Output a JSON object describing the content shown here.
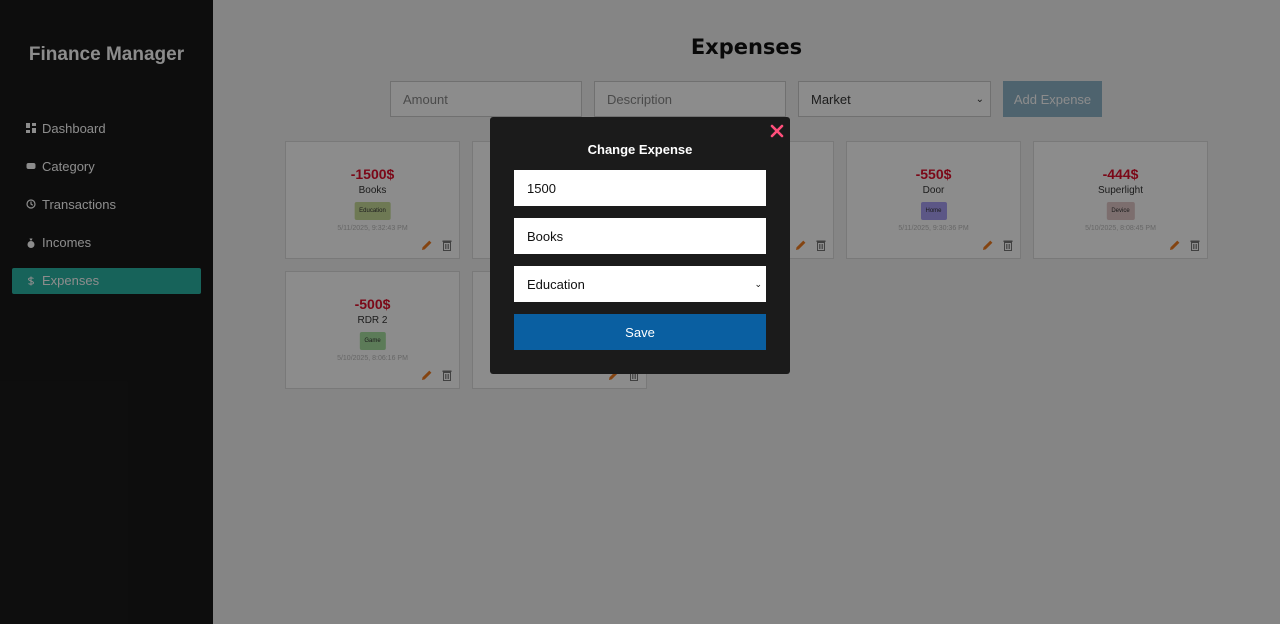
{
  "app": {
    "title": "Finance Manager"
  },
  "sidebar": {
    "items": [
      {
        "label": "Dashboard",
        "icon": "dashboard-icon",
        "active": false
      },
      {
        "label": "Category",
        "icon": "category-icon",
        "active": false
      },
      {
        "label": "Transactions",
        "icon": "history-icon",
        "active": false
      },
      {
        "label": "Incomes",
        "icon": "money-bag-icon",
        "active": false
      },
      {
        "label": "Expenses",
        "icon": "dollar-icon",
        "active": true
      }
    ]
  },
  "page": {
    "title": "Expenses"
  },
  "form": {
    "amount_placeholder": "Amount",
    "description_placeholder": "Description",
    "category_selected": "Market",
    "add_label": "Add Expense"
  },
  "cards": [
    {
      "amount": "-1500$",
      "description": "Books",
      "category": "Education",
      "category_color": "#c9dc9a",
      "date": "5/11/2025, 9:32:43 PM"
    },
    {
      "amount": "",
      "description": "",
      "category": "",
      "category_color": "",
      "date": ""
    },
    {
      "amount": "",
      "description": "",
      "category": "",
      "category_color": "",
      "date": ""
    },
    {
      "amount": "-550$",
      "description": "Door",
      "category": "Home",
      "category_color": "#a89ff5",
      "date": "5/11/2025, 9:30:36 PM"
    },
    {
      "amount": "-444$",
      "description": "Superlight",
      "category": "Device",
      "category_color": "#e2c8c8",
      "date": "5/10/2025, 8:08:45 PM"
    },
    {
      "amount": "-500$",
      "description": "RDR 2",
      "category": "Game",
      "category_color": "#a8e0a0",
      "date": "5/10/2025, 8:06:16 PM"
    },
    {
      "amount": "",
      "description": "",
      "category": "",
      "category_color": "",
      "date": ""
    }
  ],
  "modal": {
    "title": "Change Expense",
    "amount_value": "1500",
    "description_value": "Books",
    "category_value": "Education",
    "save_label": "Save"
  },
  "colors": {
    "sidebar_bg": "#191919",
    "active_nav": "#2ab5a5",
    "amount_red": "#e0102c",
    "save_button": "#0a5fa1",
    "close_icon": "#ff4f7b",
    "edit_icon": "#f07c20"
  }
}
